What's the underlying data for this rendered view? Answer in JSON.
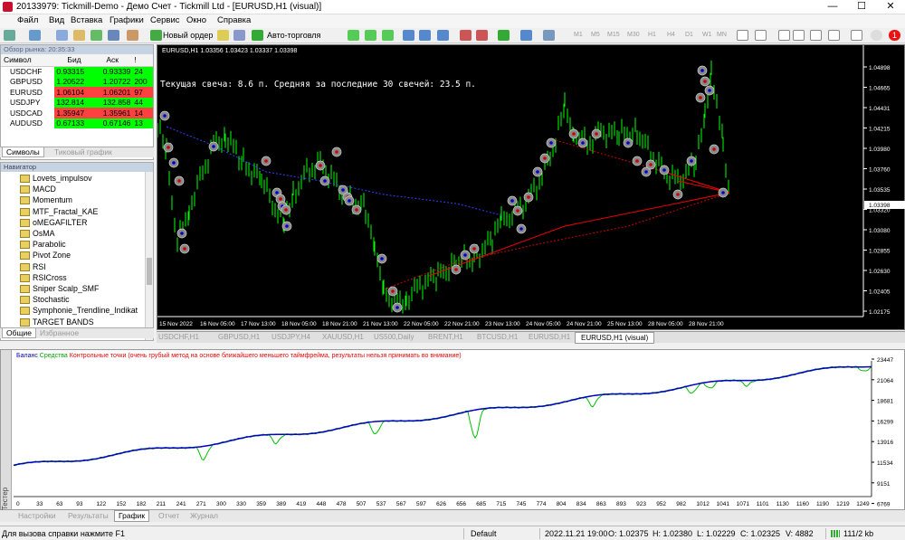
{
  "window": {
    "title": "20133979: Tickmill-Demo - Демо Счет - Tickmill Ltd - [EURUSD,H1 (visual)]",
    "minimize": "—",
    "maximize": "☐",
    "close": "✕"
  },
  "menu": [
    "Файл",
    "Вид",
    "Вставка",
    "Графики",
    "Сервис",
    "Окно",
    "Справка"
  ],
  "toolbar": {
    "new_order": "Новый ордер",
    "autotrading": "Авто-торговля",
    "timeframes": [
      "M1",
      "M5",
      "M15",
      "M30",
      "H1",
      "H4",
      "D1",
      "W1",
      "MN"
    ],
    "alert_count": "1"
  },
  "market_watch": {
    "header": "Обзор рынка: 20:35:33",
    "columns": [
      "Символ",
      "Бид",
      "Аск",
      "!"
    ],
    "rows": [
      {
        "symbol": "USDCHF",
        "bid": "0.93315",
        "ask": "0.93339",
        "spread": "24",
        "state": "up"
      },
      {
        "symbol": "GBPUSD",
        "bid": "1.20522",
        "ask": "1.20722",
        "spread": "200",
        "state": "up"
      },
      {
        "symbol": "EURUSD",
        "bid": "1.06104",
        "ask": "1.06201",
        "spread": "97",
        "state": "down"
      },
      {
        "symbol": "USDJPY",
        "bid": "132.814",
        "ask": "132.858",
        "spread": "44",
        "state": "up"
      },
      {
        "symbol": "USDCAD",
        "bid": "1.35947",
        "ask": "1.35961",
        "spread": "14",
        "state": "down"
      },
      {
        "symbol": "AUDUSD",
        "bid": "0.67133",
        "ask": "0.67146",
        "spread": "13",
        "state": "up"
      }
    ],
    "tabs": [
      "Символы",
      "Тиковый график"
    ]
  },
  "navigator": {
    "header": "Навигатор",
    "items": [
      "Lovets_impulsov",
      "MACD",
      "Momentum",
      "MTF_Fractal_KAE",
      "oMEGAFILTER",
      "OsMA",
      "Parabolic",
      "Pivot Zone",
      "RSI",
      "RSICross",
      "Sniper Scalp_SMF",
      "Stochastic",
      "Symphonie_Trendline_Indikat",
      "TARGET BANDS"
    ],
    "tabs": [
      "Общие",
      "Избранное"
    ]
  },
  "chart": {
    "symbol_info": "EURUSD,H1  1.03356 1.03423 1.03337 1.03398",
    "comment": "Текущая свеча: 8.6 п. Средняя за последние 30 свечей: 23.5 п.",
    "price_labels": [
      "1.04898",
      "1.04665",
      "1.04431",
      "1.04215",
      "1.03980",
      "1.03760",
      "1.03535",
      "1.03320",
      "1.03080",
      "1.02855",
      "1.02630",
      "1.02405",
      "1.02175"
    ],
    "current_price": "1.03398",
    "time_labels": [
      "15 Nov 2022",
      "16 Nov 05:00",
      "17 Nov 13:00",
      "18 Nov 05:00",
      "18 Nov 21:00",
      "21 Nov 13:00",
      "22 Nov 05:00",
      "22 Nov 21:00",
      "23 Nov 13:00",
      "24 Nov 05:00",
      "24 Nov 21:00",
      "25 Nov 13:00",
      "28 Nov 05:00",
      "28 Nov 21:00"
    ],
    "candle_color": "#00ff00",
    "bg_color": "#000000"
  },
  "chart_tabs": [
    "USDCHF,H1",
    "GBPUSD,H1",
    "USDJPY,H4",
    "XAUUSD,H1",
    "US500,Daily",
    "BRENT,H1",
    "BTCUSD,H1",
    "EURUSD,H1",
    "EURUSD,H1 (visual)"
  ],
  "tester": {
    "legend_balance": "Баланс",
    "legend_equity": "Средства",
    "legend_note": "Контрольные точки (очень грубый метод на основе ближайшего меньшего таймфрейма, результаты нельзя принимать во внимание)",
    "y_labels": [
      "23447",
      "21064",
      "18681",
      "16299",
      "13916",
      "11534",
      "9151",
      "6769"
    ],
    "x_labels": [
      "0",
      "33",
      "63",
      "93",
      "122",
      "152",
      "182",
      "211",
      "241",
      "271",
      "300",
      "330",
      "359",
      "389",
      "419",
      "448",
      "478",
      "507",
      "537",
      "567",
      "597",
      "626",
      "656",
      "685",
      "715",
      "745",
      "774",
      "804",
      "834",
      "863",
      "893",
      "923",
      "952",
      "982",
      "1012",
      "1041",
      "1071",
      "1101",
      "1130",
      "1160",
      "1190",
      "1219",
      "1249"
    ],
    "side_label": "Тестер",
    "balance_color": "#0000c0",
    "equity_color": "#00c000"
  },
  "bottom_tabs": [
    "Настройки",
    "Результаты",
    "График",
    "Отчет",
    "Журнал"
  ],
  "status": {
    "help": "Для вызова справки нажмите F1",
    "profile": "Default",
    "time": "2022.11.21 19:00",
    "open": "O: 1.02375",
    "high": "H: 1.02380",
    "low": "L: 1.02229",
    "close": "C: 1.02325",
    "volume": "V: 4882",
    "traffic": "111/2 kb"
  }
}
